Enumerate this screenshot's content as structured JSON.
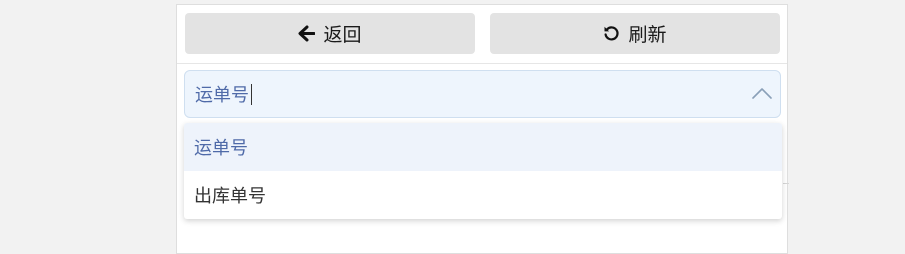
{
  "toolbar": {
    "back_label": "返回",
    "back_icon": "arrow-left-icon",
    "refresh_label": "刷新",
    "refresh_icon": "refresh-icon"
  },
  "select": {
    "value": "运单号",
    "expanded": true,
    "chevron_icon": "chevron-up-icon",
    "options": [
      {
        "label": "运单号",
        "selected": true
      },
      {
        "label": "出库单号",
        "selected": false
      }
    ]
  },
  "colors": {
    "button_bg": "#e3e3e3",
    "select_bg": "#eef5fd",
    "selected_text": "#4f6aa8",
    "page_bg": "#f2f2f2"
  }
}
